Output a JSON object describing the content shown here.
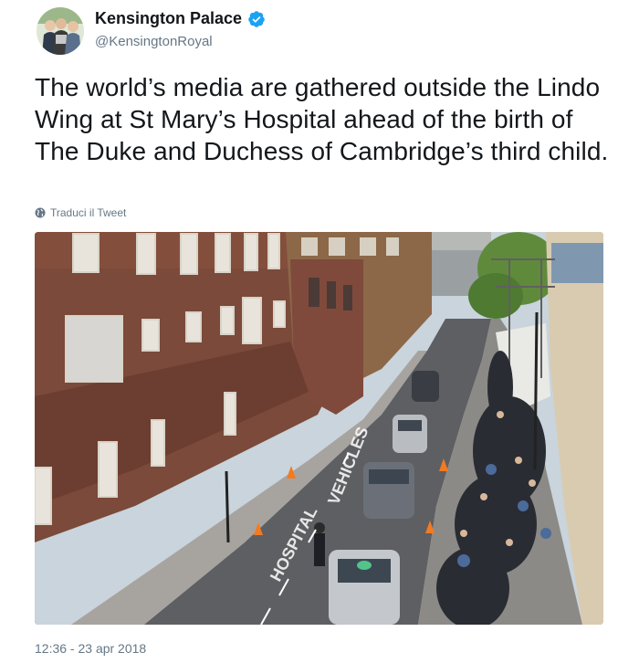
{
  "author": {
    "name": "Kensington Palace",
    "handle": "@KensingtonRoyal",
    "verified": true,
    "avatar_icon": "avatar-photo"
  },
  "tweet": {
    "text": "The world’s media are gathered outside the Lindo Wing at St Mary’s Hospital ahead of the birth of The Duke and Duchess of Cambridge’s third child.",
    "translate_label": "Traduci il Tweet",
    "translate_icon": "globe-icon",
    "timestamp": "12:36 - 23 apr 2018"
  },
  "photo": {
    "road_markings": [
      "HOSPITAL",
      "VEHICLES"
    ]
  },
  "colors": {
    "verified_blue": "#1da1f2",
    "text_secondary": "#657786",
    "text_primary": "#14171a"
  }
}
